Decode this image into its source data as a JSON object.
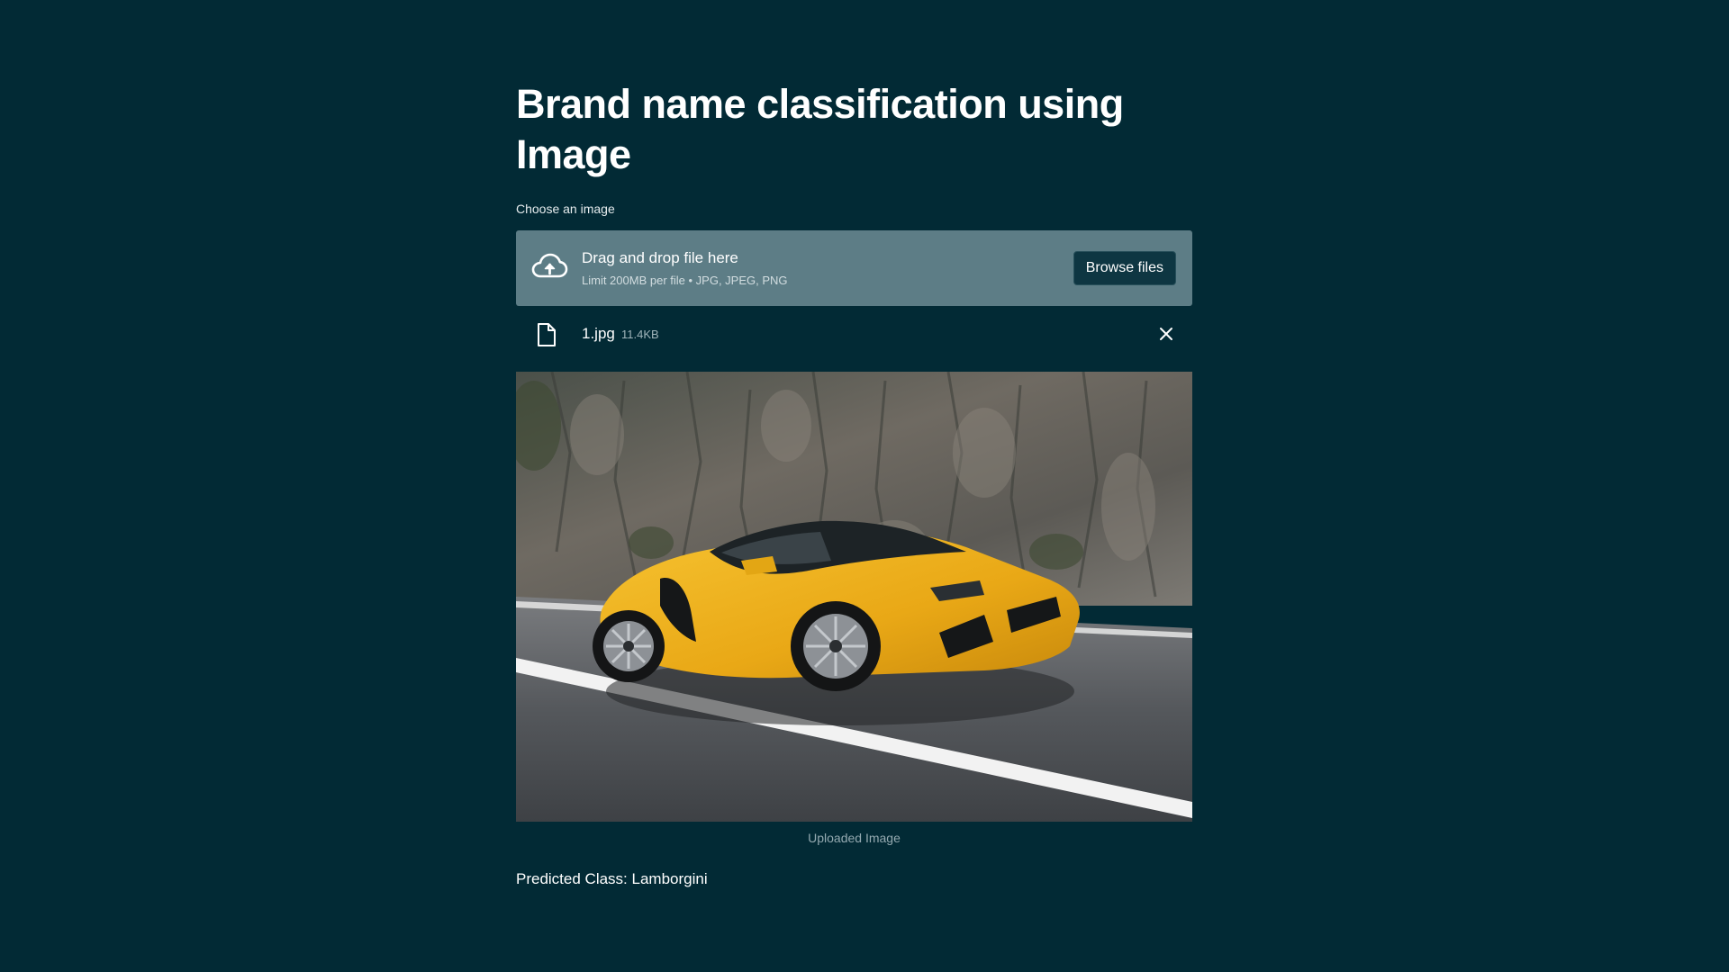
{
  "page": {
    "title": "Brand name classification using Image"
  },
  "uploader": {
    "label": "Choose an image",
    "drop_text": "Drag and drop file here",
    "limit_text": "Limit 200MB per file • JPG, JPEG, PNG",
    "browse_label": "Browse files",
    "icon": "cloud-upload-icon"
  },
  "file": {
    "name": "1.jpg",
    "size": "11.4KB",
    "icon": "file-icon",
    "remove_icon": "close-icon"
  },
  "image": {
    "caption": "Uploaded Image",
    "subject": "yellow sports car on road in front of rock wall"
  },
  "result": {
    "text": "Predicted Class: Lamborgini"
  },
  "colors": {
    "background": "#022a35",
    "dropzone": "#5d7d86",
    "button": "#0e3642",
    "car": "#f2b51c"
  }
}
